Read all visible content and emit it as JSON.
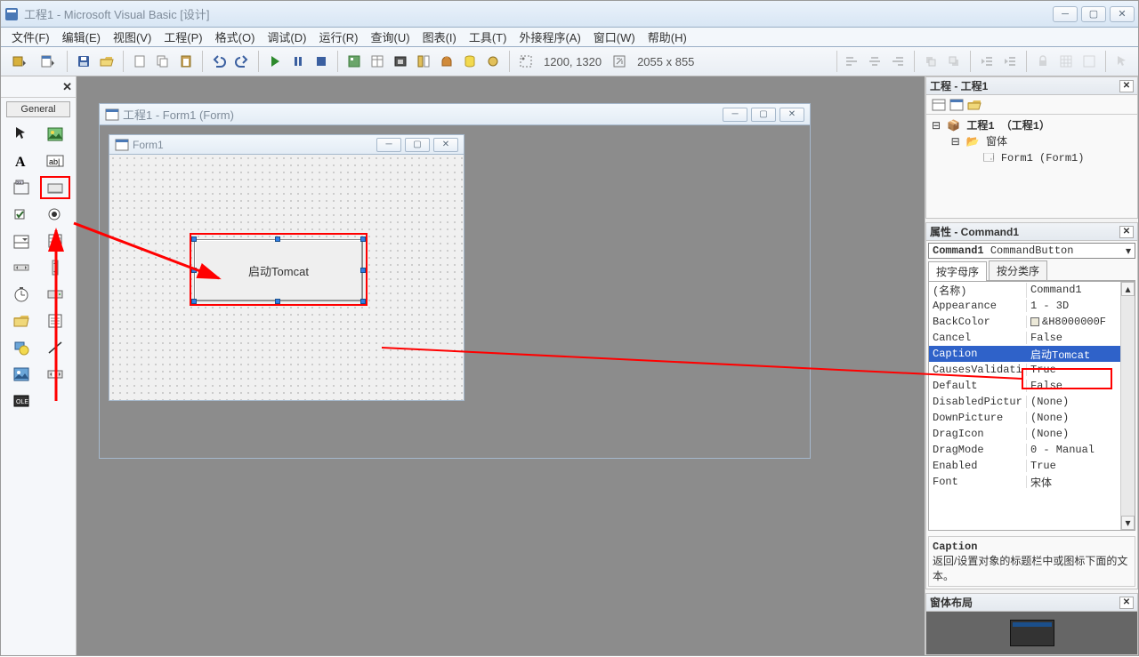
{
  "app": {
    "title": "工程1 - Microsoft Visual Basic [设计]",
    "coords": "1200, 1320",
    "size": "2055 x 855"
  },
  "menu": {
    "file": "文件(F)",
    "edit": "编辑(E)",
    "view": "视图(V)",
    "project": "工程(P)",
    "format": "格式(O)",
    "debug": "调试(D)",
    "run": "运行(R)",
    "query": "查询(U)",
    "diagram": "图表(I)",
    "tools": "工具(T)",
    "addins": "外接程序(A)",
    "window": "窗口(W)",
    "help": "帮助(H)"
  },
  "toolbox": {
    "close": "✕",
    "tab": "General"
  },
  "design_window": {
    "title": "工程1 - Form1 (Form)"
  },
  "form": {
    "title": "Form1",
    "button_caption": "启动Tomcat"
  },
  "project_panel": {
    "title": "工程 - 工程1",
    "root": "工程1 （工程1）",
    "folder": "窗体",
    "item": "Form1 (Form1)"
  },
  "props_panel": {
    "title": "属性 - Command1",
    "combo_name": "Command1",
    "combo_type": "CommandButton",
    "tab_alpha": "按字母序",
    "tab_cat": "按分类序",
    "rows": [
      {
        "n": "(名称)",
        "v": "Command1"
      },
      {
        "n": "Appearance",
        "v": "1 - 3D"
      },
      {
        "n": "BackColor",
        "v": "&H8000000F"
      },
      {
        "n": "Cancel",
        "v": "False"
      },
      {
        "n": "Caption",
        "v": "启动Tomcat",
        "sel": true
      },
      {
        "n": "CausesValidati",
        "v": "True"
      },
      {
        "n": "Default",
        "v": "False"
      },
      {
        "n": "DisabledPictur",
        "v": "(None)"
      },
      {
        "n": "DownPicture",
        "v": "(None)"
      },
      {
        "n": "DragIcon",
        "v": "(None)"
      },
      {
        "n": "DragMode",
        "v": "0 - Manual"
      },
      {
        "n": "Enabled",
        "v": "True"
      },
      {
        "n": "Font",
        "v": "宋体"
      }
    ],
    "help_title": "Caption",
    "help_text": "返回/设置对象的标题栏中或图标下面的文本。"
  },
  "formlayout_panel": {
    "title": "窗体布局"
  }
}
